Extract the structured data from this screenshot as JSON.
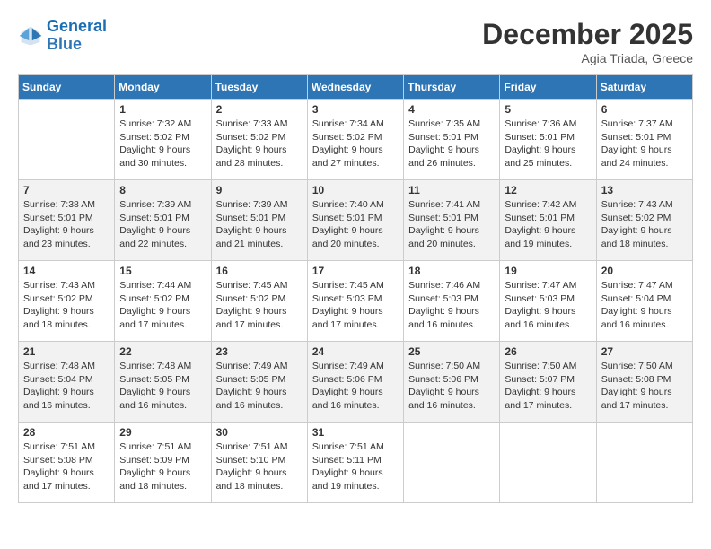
{
  "logo": {
    "text_general": "General",
    "text_blue": "Blue"
  },
  "header": {
    "month": "December 2025",
    "location": "Agia Triada, Greece"
  },
  "days_of_week": [
    "Sunday",
    "Monday",
    "Tuesday",
    "Wednesday",
    "Thursday",
    "Friday",
    "Saturday"
  ],
  "weeks": [
    [
      {
        "day": "",
        "info": ""
      },
      {
        "day": "1",
        "info": "Sunrise: 7:32 AM\nSunset: 5:02 PM\nDaylight: 9 hours\nand 30 minutes."
      },
      {
        "day": "2",
        "info": "Sunrise: 7:33 AM\nSunset: 5:02 PM\nDaylight: 9 hours\nand 28 minutes."
      },
      {
        "day": "3",
        "info": "Sunrise: 7:34 AM\nSunset: 5:02 PM\nDaylight: 9 hours\nand 27 minutes."
      },
      {
        "day": "4",
        "info": "Sunrise: 7:35 AM\nSunset: 5:01 PM\nDaylight: 9 hours\nand 26 minutes."
      },
      {
        "day": "5",
        "info": "Sunrise: 7:36 AM\nSunset: 5:01 PM\nDaylight: 9 hours\nand 25 minutes."
      },
      {
        "day": "6",
        "info": "Sunrise: 7:37 AM\nSunset: 5:01 PM\nDaylight: 9 hours\nand 24 minutes."
      }
    ],
    [
      {
        "day": "7",
        "info": "Sunrise: 7:38 AM\nSunset: 5:01 PM\nDaylight: 9 hours\nand 23 minutes."
      },
      {
        "day": "8",
        "info": "Sunrise: 7:39 AM\nSunset: 5:01 PM\nDaylight: 9 hours\nand 22 minutes."
      },
      {
        "day": "9",
        "info": "Sunrise: 7:39 AM\nSunset: 5:01 PM\nDaylight: 9 hours\nand 21 minutes."
      },
      {
        "day": "10",
        "info": "Sunrise: 7:40 AM\nSunset: 5:01 PM\nDaylight: 9 hours\nand 20 minutes."
      },
      {
        "day": "11",
        "info": "Sunrise: 7:41 AM\nSunset: 5:01 PM\nDaylight: 9 hours\nand 20 minutes."
      },
      {
        "day": "12",
        "info": "Sunrise: 7:42 AM\nSunset: 5:01 PM\nDaylight: 9 hours\nand 19 minutes."
      },
      {
        "day": "13",
        "info": "Sunrise: 7:43 AM\nSunset: 5:02 PM\nDaylight: 9 hours\nand 18 minutes."
      }
    ],
    [
      {
        "day": "14",
        "info": "Sunrise: 7:43 AM\nSunset: 5:02 PM\nDaylight: 9 hours\nand 18 minutes."
      },
      {
        "day": "15",
        "info": "Sunrise: 7:44 AM\nSunset: 5:02 PM\nDaylight: 9 hours\nand 17 minutes."
      },
      {
        "day": "16",
        "info": "Sunrise: 7:45 AM\nSunset: 5:02 PM\nDaylight: 9 hours\nand 17 minutes."
      },
      {
        "day": "17",
        "info": "Sunrise: 7:45 AM\nSunset: 5:03 PM\nDaylight: 9 hours\nand 17 minutes."
      },
      {
        "day": "18",
        "info": "Sunrise: 7:46 AM\nSunset: 5:03 PM\nDaylight: 9 hours\nand 16 minutes."
      },
      {
        "day": "19",
        "info": "Sunrise: 7:47 AM\nSunset: 5:03 PM\nDaylight: 9 hours\nand 16 minutes."
      },
      {
        "day": "20",
        "info": "Sunrise: 7:47 AM\nSunset: 5:04 PM\nDaylight: 9 hours\nand 16 minutes."
      }
    ],
    [
      {
        "day": "21",
        "info": "Sunrise: 7:48 AM\nSunset: 5:04 PM\nDaylight: 9 hours\nand 16 minutes."
      },
      {
        "day": "22",
        "info": "Sunrise: 7:48 AM\nSunset: 5:05 PM\nDaylight: 9 hours\nand 16 minutes."
      },
      {
        "day": "23",
        "info": "Sunrise: 7:49 AM\nSunset: 5:05 PM\nDaylight: 9 hours\nand 16 minutes."
      },
      {
        "day": "24",
        "info": "Sunrise: 7:49 AM\nSunset: 5:06 PM\nDaylight: 9 hours\nand 16 minutes."
      },
      {
        "day": "25",
        "info": "Sunrise: 7:50 AM\nSunset: 5:06 PM\nDaylight: 9 hours\nand 16 minutes."
      },
      {
        "day": "26",
        "info": "Sunrise: 7:50 AM\nSunset: 5:07 PM\nDaylight: 9 hours\nand 17 minutes."
      },
      {
        "day": "27",
        "info": "Sunrise: 7:50 AM\nSunset: 5:08 PM\nDaylight: 9 hours\nand 17 minutes."
      }
    ],
    [
      {
        "day": "28",
        "info": "Sunrise: 7:51 AM\nSunset: 5:08 PM\nDaylight: 9 hours\nand 17 minutes."
      },
      {
        "day": "29",
        "info": "Sunrise: 7:51 AM\nSunset: 5:09 PM\nDaylight: 9 hours\nand 18 minutes."
      },
      {
        "day": "30",
        "info": "Sunrise: 7:51 AM\nSunset: 5:10 PM\nDaylight: 9 hours\nand 18 minutes."
      },
      {
        "day": "31",
        "info": "Sunrise: 7:51 AM\nSunset: 5:11 PM\nDaylight: 9 hours\nand 19 minutes."
      },
      {
        "day": "",
        "info": ""
      },
      {
        "day": "",
        "info": ""
      },
      {
        "day": "",
        "info": ""
      }
    ]
  ]
}
